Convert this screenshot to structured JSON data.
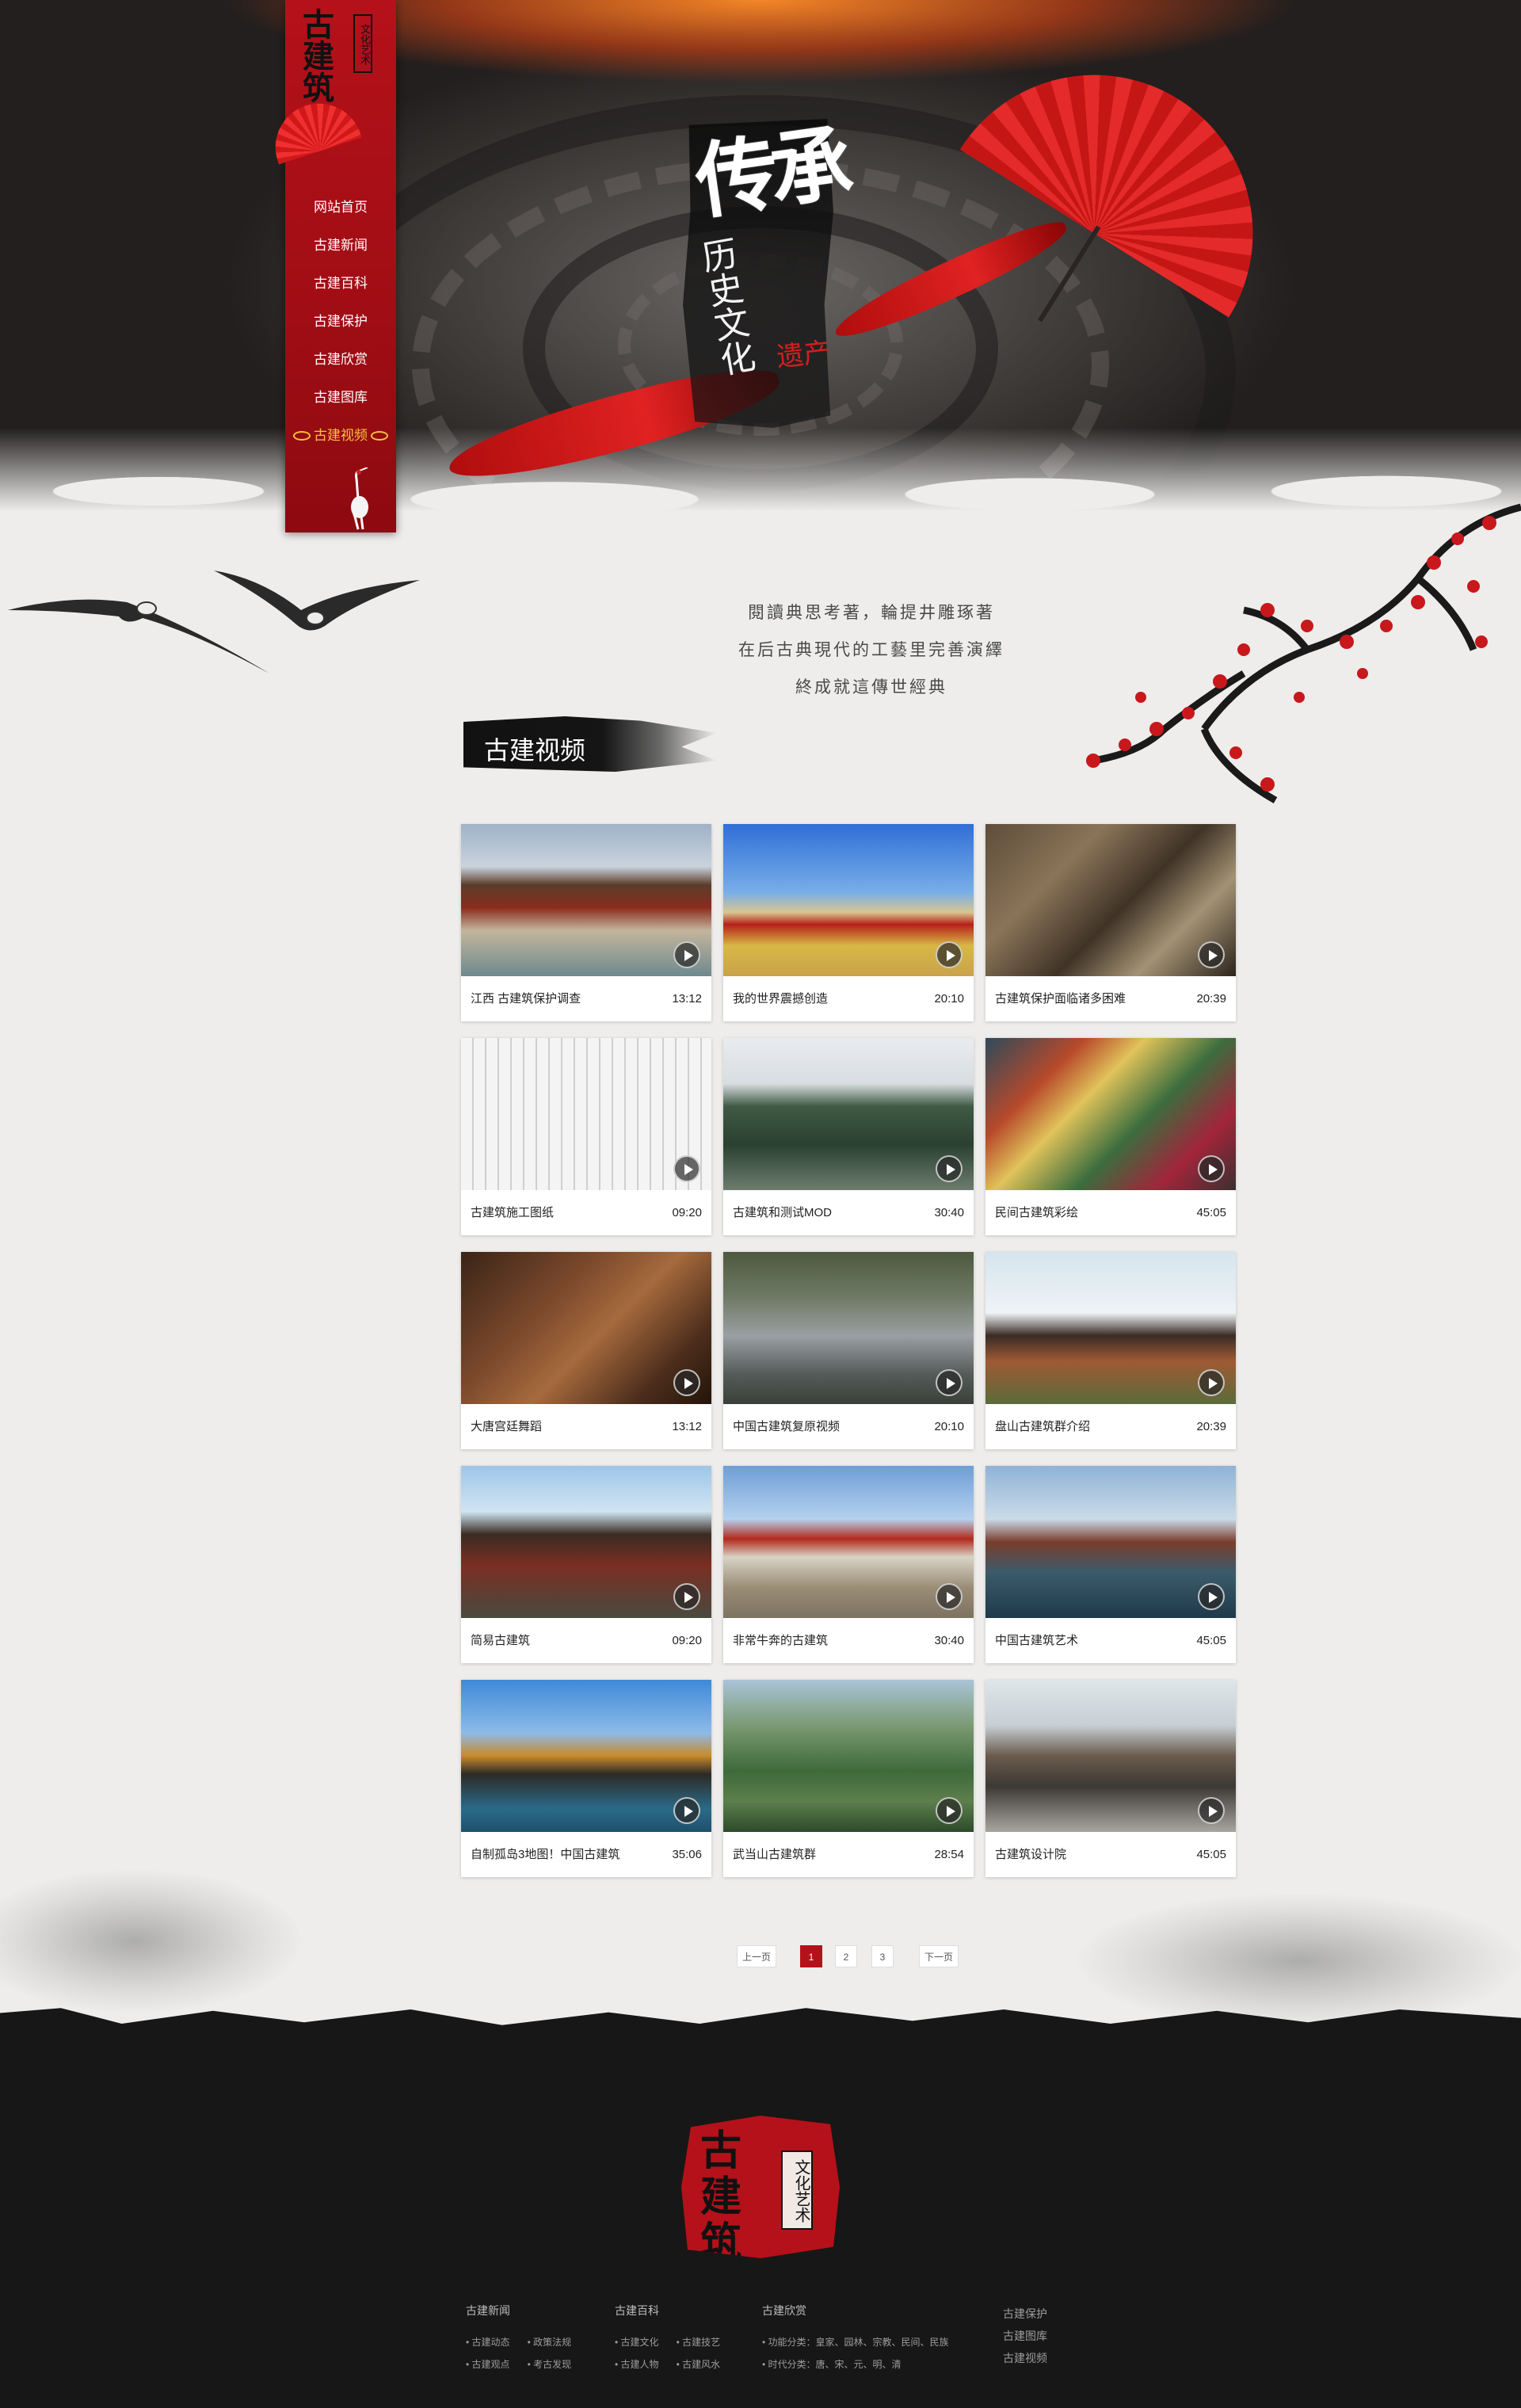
{
  "hero": {
    "title_main": "传承",
    "title_vertical": "历史文化",
    "title_red": "遗产"
  },
  "sidenav": {
    "logo_text": "古建筑",
    "logo_tag": "文化艺术",
    "items": [
      {
        "label": "网站首页"
      },
      {
        "label": "古建新闻"
      },
      {
        "label": "古建百科"
      },
      {
        "label": "古建保护"
      },
      {
        "label": "古建欣赏"
      },
      {
        "label": "古建图库"
      },
      {
        "label": "古建视频"
      }
    ],
    "active_index": 6
  },
  "intro": {
    "lines": [
      "閱讀典思考著，輪提井雕琢著",
      "在后古典現代的工藝里完善演繹",
      "終成就這傳世經典"
    ]
  },
  "section": {
    "title": "古建视频"
  },
  "videos": [
    {
      "title": "江西 古建筑保护调查",
      "duration": "13:12"
    },
    {
      "title": "我的世界震撼创造",
      "duration": "20:10"
    },
    {
      "title": "古建筑保护面临诸多困难",
      "duration": "20:39"
    },
    {
      "title": "古建筑施工图纸",
      "duration": "09:20"
    },
    {
      "title": "古建筑和测试MOD",
      "duration": "30:40"
    },
    {
      "title": "民间古建筑彩绘",
      "duration": "45:05"
    },
    {
      "title": "大唐宫廷舞蹈",
      "duration": "13:12"
    },
    {
      "title": "中国古建筑复原视频",
      "duration": "20:10"
    },
    {
      "title": "盘山古建筑群介绍",
      "duration": "20:39"
    },
    {
      "title": "简易古建筑",
      "duration": "09:20"
    },
    {
      "title": "非常牛奔的古建筑",
      "duration": "30:40"
    },
    {
      "title": "中国古建筑艺术",
      "duration": "45:05"
    },
    {
      "title": "自制孤岛3地图！中国古建筑",
      "duration": "35:06"
    },
    {
      "title": "武当山古建筑群",
      "duration": "28:54"
    },
    {
      "title": "古建筑设计院",
      "duration": "45:05"
    }
  ],
  "pager": {
    "prev": "上一页",
    "pages": [
      "1",
      "2",
      "3"
    ],
    "current": "1",
    "next": "下一页"
  },
  "footer": {
    "logo_text": "古建筑",
    "logo_tag": "文化艺术",
    "cols": [
      {
        "title": "古建新闻",
        "rows": [
          [
            "古建动态",
            "政策法规"
          ],
          [
            "古建观点",
            "考古发现"
          ]
        ]
      },
      {
        "title": "古建百科",
        "rows": [
          [
            "古建文化",
            "古建技艺"
          ],
          [
            "古建人物",
            "古建风水"
          ]
        ]
      },
      {
        "title": "古建欣赏",
        "rows": [
          [
            "功能分类：皇家、园林、宗教、民间、民族"
          ],
          [
            "时代分类：唐、宋、元、明、清"
          ]
        ]
      },
      {
        "title": "",
        "rows": [
          [
            "古建保护"
          ],
          [
            "古建图库"
          ],
          [
            "古建视频"
          ]
        ]
      }
    ]
  },
  "colors": {
    "brand_red": "#b5111a",
    "nav_active": "#f5c33b",
    "footer_bg": "#171717",
    "page_bg": "#eeedeb"
  }
}
